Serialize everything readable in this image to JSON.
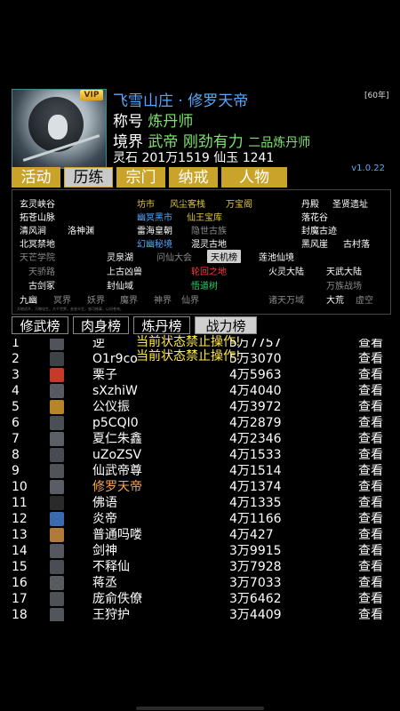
{
  "header": {
    "title": "飞雪山庄 · 修罗天帝",
    "vip_badge": "VIP",
    "level_tag": "[60年]",
    "title_label": "称号",
    "title_value": "炼丹师",
    "realm_label": "境界",
    "realm_value": "武帝",
    "realm_trait": "刚劲有力",
    "realm_rank": "二品炼丹师",
    "currency": "灵石 201万1519  仙玉 1241"
  },
  "tabs": [
    "活动",
    "历练",
    "宗门",
    "纳戒",
    "人物"
  ],
  "version": "v1.0.22",
  "map": {
    "locations": [
      {
        "name": "玄灵峡谷",
        "color": "white"
      },
      {
        "name": "坊市",
        "color": "yellow"
      },
      {
        "name": "风尘客栈",
        "color": "yellow"
      },
      {
        "name": "万宝阁",
        "color": "yellow"
      },
      {
        "name": "丹殿",
        "color": "white"
      },
      {
        "name": "圣贤遗址",
        "color": "white"
      },
      {
        "name": "拓苍山脉",
        "color": "white"
      },
      {
        "name": "幽冥黑市",
        "color": "blue"
      },
      {
        "name": "仙王宝库",
        "color": "yellow"
      },
      {
        "name": "落花谷",
        "color": "white"
      },
      {
        "name": "清风涧",
        "color": "white"
      },
      {
        "name": "洛神渊",
        "color": "white"
      },
      {
        "name": "雷海皇朝",
        "color": "white"
      },
      {
        "name": "隐世古族",
        "color": "gray"
      },
      {
        "name": "封魔古迹",
        "color": "white"
      },
      {
        "name": "北冥禁地",
        "color": "white"
      },
      {
        "name": "幻幽秘境",
        "color": "blue"
      },
      {
        "name": "混灵古地",
        "color": "white"
      },
      {
        "name": "黑风崖",
        "color": "white"
      },
      {
        "name": "古村落",
        "color": "white"
      },
      {
        "name": "天芒学院",
        "color": "gray"
      },
      {
        "name": "灵泉湖",
        "color": "white"
      },
      {
        "name": "问仙大会",
        "color": "gray"
      },
      {
        "name": "天机榜",
        "color": "boxed"
      },
      {
        "name": "莲池仙境",
        "color": "white"
      },
      {
        "name": "天骄路",
        "color": "gray"
      },
      {
        "name": "上古凶兽",
        "color": "white"
      },
      {
        "name": "轮回之地",
        "color": "red"
      },
      {
        "name": "火灵大陆",
        "color": "white"
      },
      {
        "name": "天武大陆",
        "color": "white"
      },
      {
        "name": "古剑冢",
        "color": "white"
      },
      {
        "name": "封仙域",
        "color": "white"
      },
      {
        "name": "悟道树",
        "color": "green"
      },
      {
        "name": "万族战场",
        "color": "gray"
      },
      {
        "name": "九幽",
        "color": "white"
      },
      {
        "name": "冥界",
        "color": "gray"
      },
      {
        "name": "妖界",
        "color": "gray"
      },
      {
        "name": "魔界",
        "color": "gray"
      },
      {
        "name": "神界",
        "color": "gray"
      },
      {
        "name": "仙界",
        "color": "gray"
      },
      {
        "name": "诸天万域",
        "color": "gray"
      },
      {
        "name": "大荒",
        "color": "white"
      },
      {
        "name": "虚空",
        "color": "gray"
      }
    ],
    "note": "天地初开，万物化生，大千世界，芸芸众生，皆可修真，以问苍穹。"
  },
  "subtabs": [
    "修武榜",
    "肉身榜",
    "炼丹榜",
    "战力榜"
  ],
  "active_subtab": 3,
  "notices": [
    "当前状态禁止操作!",
    "当前状态禁止操作!"
  ],
  "rank_list": {
    "view_label": "查看",
    "rows": [
      {
        "rank": "1",
        "name": "逆",
        "score": "5万7757",
        "avatar": "#50545a"
      },
      {
        "rank": "2",
        "name": "O1r9co",
        "score": "5万3070",
        "avatar": "#3d4247"
      },
      {
        "rank": "3",
        "name": "栗子",
        "score": "4万5963",
        "avatar": "#c63a2a"
      },
      {
        "rank": "4",
        "name": "sXzhiW",
        "score": "4万4040",
        "avatar": "#555b61"
      },
      {
        "rank": "5",
        "name": "公仪振",
        "score": "4万3972",
        "avatar": "#b8842a"
      },
      {
        "rank": "6",
        "name": "p5CQI0",
        "score": "4万2879",
        "avatar": "#4a4f55"
      },
      {
        "rank": "7",
        "name": "夏仁朱鑫",
        "score": "4万2346",
        "avatar": "#5b6066"
      },
      {
        "rank": "8",
        "name": "uZoZSV",
        "score": "4万1533",
        "avatar": "#474c52"
      },
      {
        "rank": "9",
        "name": "仙武帝尊",
        "score": "4万1514",
        "avatar": "#505459"
      },
      {
        "rank": "10",
        "name": "修罗天帝",
        "score": "4万1374",
        "avatar": "#5a5e64",
        "me": true
      },
      {
        "rank": "11",
        "name": "佛语",
        "score": "4万1335",
        "avatar": "#2a2a2a"
      },
      {
        "rank": "12",
        "name": "炎帝",
        "score": "4万1166",
        "avatar": "#3a6ab0"
      },
      {
        "rank": "13",
        "name": "普通吗喽",
        "score": "4万427",
        "avatar": "#b07a3a"
      },
      {
        "rank": "14",
        "name": "剑神",
        "score": "3万9915",
        "avatar": "#55595f"
      },
      {
        "rank": "15",
        "name": "不释仙",
        "score": "3万7928",
        "avatar": "#4a4e54"
      },
      {
        "rank": "16",
        "name": "蒋丞",
        "score": "3万7033",
        "avatar": "#585c61"
      },
      {
        "rank": "17",
        "name": "庞俞佚僚",
        "score": "3万6462",
        "avatar": "#4e5257"
      },
      {
        "rank": "18",
        "name": "王狩护",
        "score": "3万4409",
        "avatar": "#52565b"
      }
    ]
  }
}
